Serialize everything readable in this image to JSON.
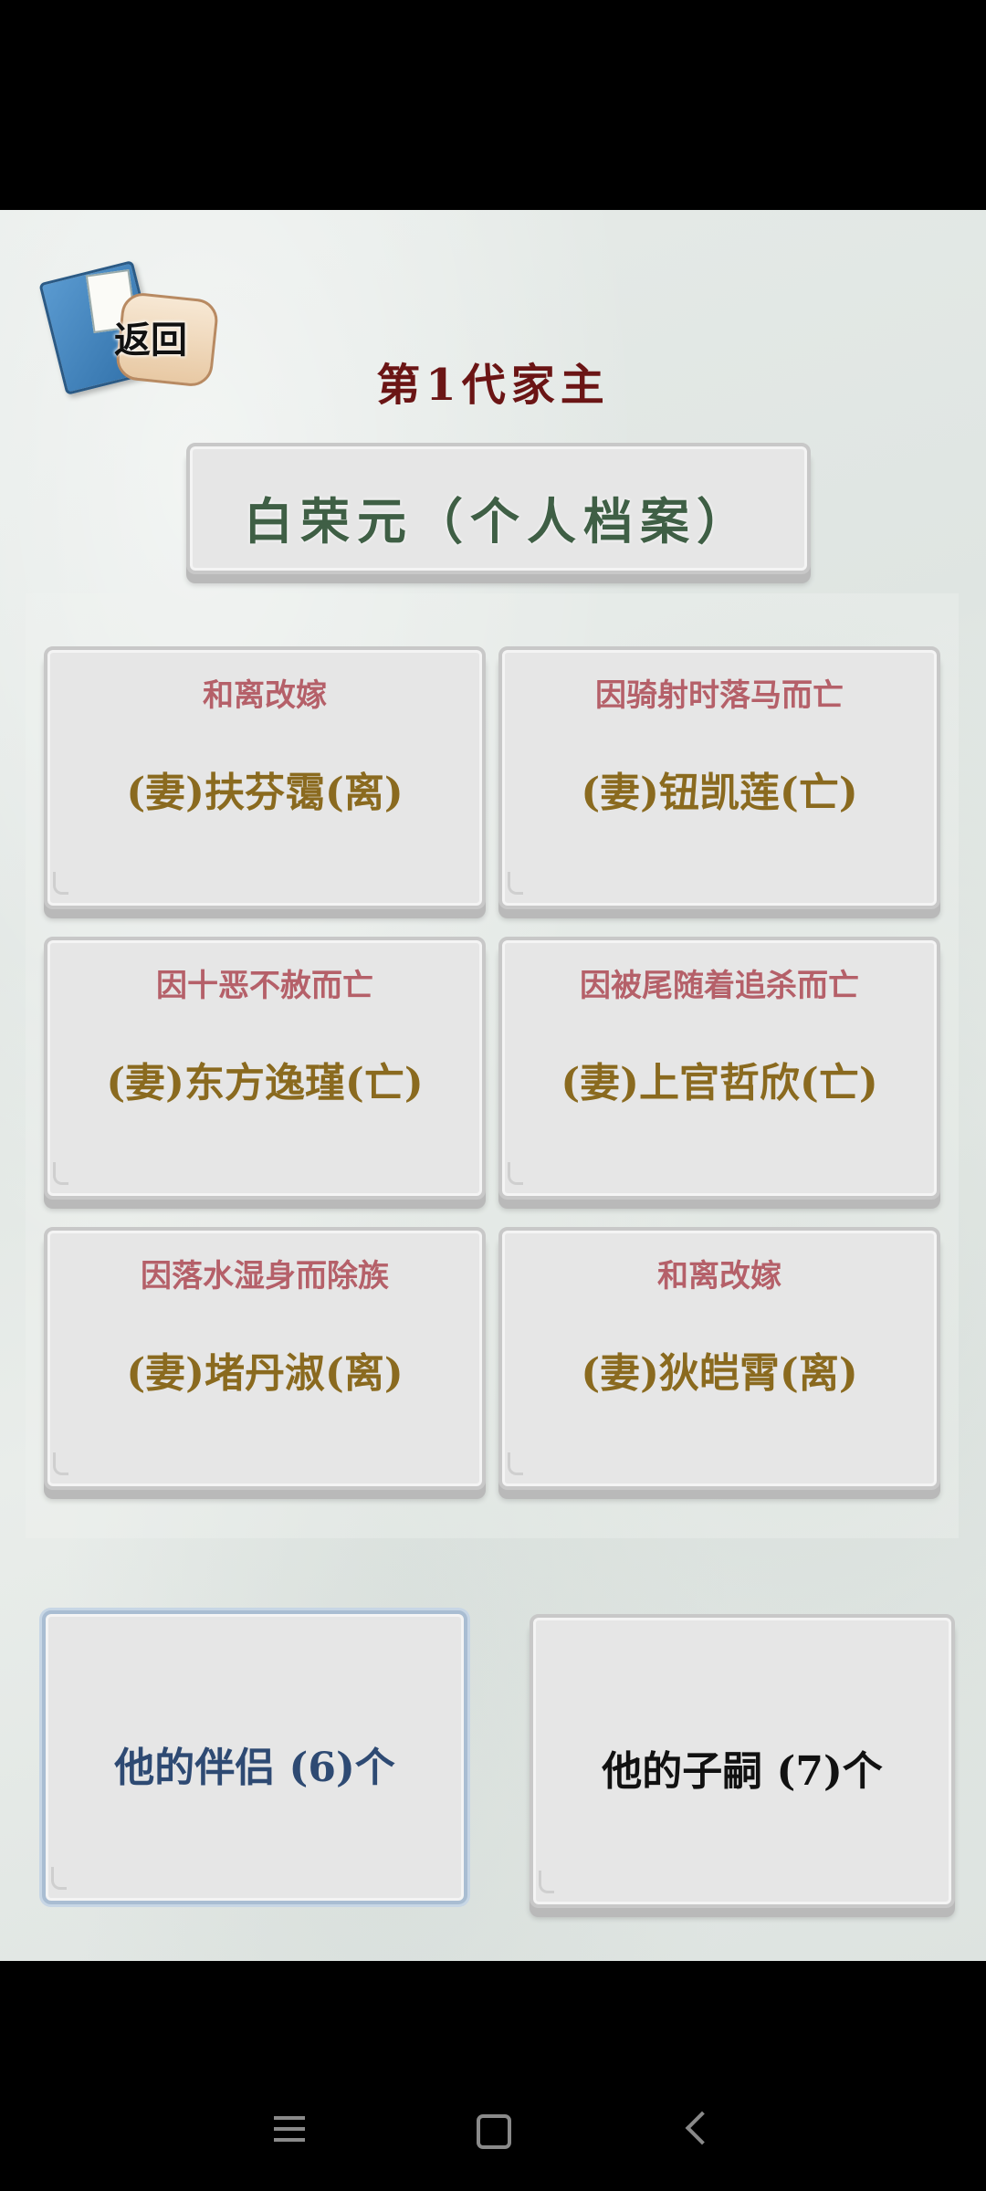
{
  "header": {
    "back_label": "返回",
    "generation_title": "第1代家主",
    "name_plate": "白荣元（个人档案）"
  },
  "cards": [
    {
      "cause": "和离改嫁",
      "spouse": "(妻)扶芬霭(离)"
    },
    {
      "cause": "因骑射时落马而亡",
      "spouse": "(妻)钮凯莲(亡)"
    },
    {
      "cause": "因十恶不赦而亡",
      "spouse": "(妻)东方逸瑾(亡)"
    },
    {
      "cause": "因被尾随着追杀而亡",
      "spouse": "(妻)上官哲欣(亡)"
    },
    {
      "cause": "因落水湿身而除族",
      "spouse": "(妻)堵丹淑(离)"
    },
    {
      "cause": "和离改嫁",
      "spouse": "(妻)狄皑霄(离)"
    }
  ],
  "bottom": {
    "partners_label": "他的伴侣 (6)个",
    "children_label": "他的子嗣 (7)个"
  },
  "colors": {
    "title_red": "#6b1515",
    "name_green": "#3f5f45",
    "cause_pink": "#b56069",
    "spouse_gold": "#8a6a1f",
    "partners_blue": "#2e4a73"
  },
  "icons": {
    "back": "book-scroll-icon",
    "nav_menu": "menu-icon",
    "nav_home": "home-square-icon",
    "nav_back": "back-chevron-icon"
  }
}
